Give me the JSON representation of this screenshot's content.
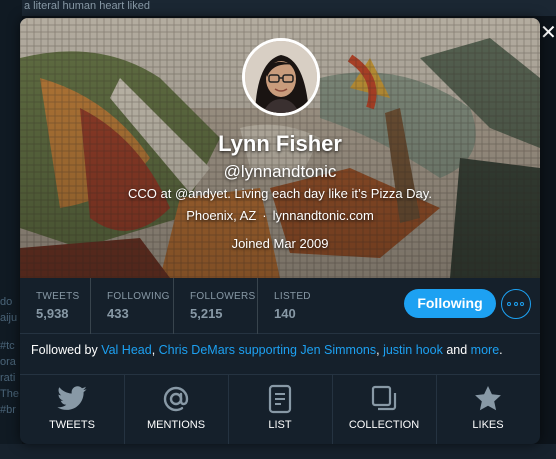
{
  "background": {
    "top_text": "a literal human heart liked",
    "left_fragments": [
      "do",
      "aiju",
      "#tc",
      "ora",
      "rati",
      "The",
      "#br"
    ]
  },
  "close": {
    "glyph": "✕"
  },
  "profile": {
    "name": "Lynn Fisher",
    "handle": "@lynnandtonic",
    "bio": "CCO at @andyet. Living each day like it’s Pizza Day.",
    "location": "Phoenix, AZ",
    "separator": "·",
    "website": "lynnandtonic.com",
    "joined": "Joined Mar 2009"
  },
  "stats": [
    {
      "label": "TWEETS",
      "value": "5,938"
    },
    {
      "label": "FOLLOWING",
      "value": "433"
    },
    {
      "label": "FOLLOWERS",
      "value": "5,215"
    },
    {
      "label": "LISTED",
      "value": "140"
    }
  ],
  "actions": {
    "following_label": "Following",
    "more_icon": "more-icon"
  },
  "followed_by": {
    "prefix": "Followed by",
    "users": [
      "Val Head",
      "Chris DeMars supporting Jen Simmons",
      "justin hook"
    ],
    "comma": ",",
    "and": "and",
    "more": "more",
    "period": "."
  },
  "tabs": [
    {
      "label": "TWEETS",
      "icon": "bird-icon"
    },
    {
      "label": "MENTIONS",
      "icon": "at-icon"
    },
    {
      "label": "LIST",
      "icon": "list-icon"
    },
    {
      "label": "COLLECTION",
      "icon": "collection-icon"
    },
    {
      "label": "LIKES",
      "icon": "star-icon"
    }
  ],
  "colors": {
    "accent": "#1da1f2",
    "background": "#15202b",
    "muted": "#8899a6"
  }
}
